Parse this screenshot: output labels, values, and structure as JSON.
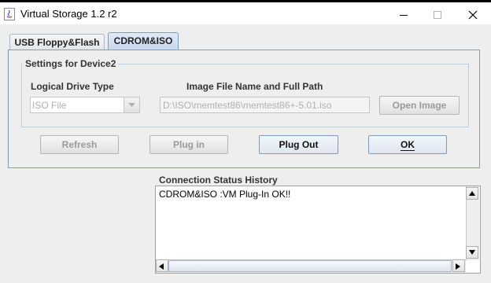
{
  "window": {
    "title": "Virtual Storage 1.2 r2"
  },
  "tabs": [
    {
      "label": "USB Floppy&Flash"
    },
    {
      "label": "CDROM&ISO"
    }
  ],
  "settings": {
    "group_title": "Settings for Device2",
    "drive_type_label": "Logical Drive Type",
    "drive_type_value": "ISO File",
    "image_path_label": "Image File Name and Full Path",
    "image_path_value": "D:\\ISO\\memtest86\\memtest86+-5.01.iso",
    "open_image_label": "Open Image"
  },
  "actions": {
    "refresh": "Refresh",
    "plug_in": "Plug in",
    "plug_out": "Plug Out",
    "ok": "OK"
  },
  "history": {
    "title": "Connection Status History",
    "lines": [
      "CDROM&ISO :VM Plug-In OK!!"
    ]
  }
}
